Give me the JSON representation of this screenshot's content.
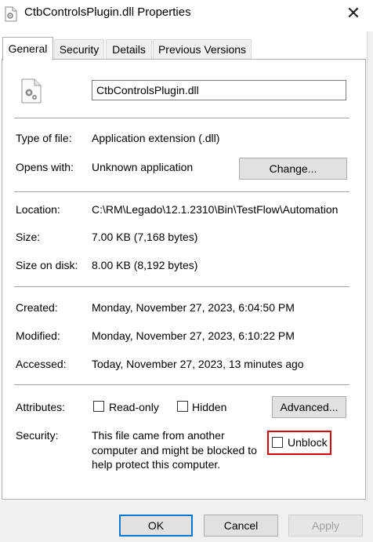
{
  "window": {
    "title": "CtbControlsPlugin.dll Properties",
    "close_label": "✕"
  },
  "tabs": [
    {
      "label": "General",
      "active": true
    },
    {
      "label": "Security",
      "active": false
    },
    {
      "label": "Details",
      "active": false
    },
    {
      "label": "Previous Versions",
      "active": false
    }
  ],
  "general": {
    "file_name": "CtbControlsPlugin.dll",
    "type_label": "Type of file:",
    "type_value": "Application extension (.dll)",
    "opens_label": "Opens with:",
    "opens_value": "Unknown application",
    "change_button": "Change...",
    "location_label": "Location:",
    "location_value": "C:\\RM\\Legado\\12.1.2310\\Bin\\TestFlow\\Automation",
    "size_label": "Size:",
    "size_value": "7.00 KB (7,168 bytes)",
    "size_disk_label": "Size on disk:",
    "size_disk_value": "8.00 KB (8,192 bytes)",
    "created_label": "Created:",
    "created_value": "Monday, November 27, 2023, 6:04:50 PM",
    "modified_label": "Modified:",
    "modified_value": "Monday, November 27, 2023, 6:10:22 PM",
    "accessed_label": "Accessed:",
    "accessed_value": "Today, November 27, 2023, 13 minutes ago",
    "attributes_label": "Attributes:",
    "readonly_label": "Read-only",
    "hidden_label": "Hidden",
    "advanced_button": "Advanced...",
    "security_label": "Security:",
    "security_line1": "This file came from another",
    "security_line2": "computer and might be blocked to",
    "security_line3": "help protect this computer.",
    "unblock_label": "Unblock"
  },
  "footer": {
    "ok": "OK",
    "cancel": "Cancel",
    "apply": "Apply"
  },
  "colors": {
    "highlight": "#d60000",
    "focus_border": "#0078d7"
  },
  "icons": {
    "title": "dll-file-icon",
    "file": "dll-gear-file-icon",
    "close": "close-icon"
  }
}
